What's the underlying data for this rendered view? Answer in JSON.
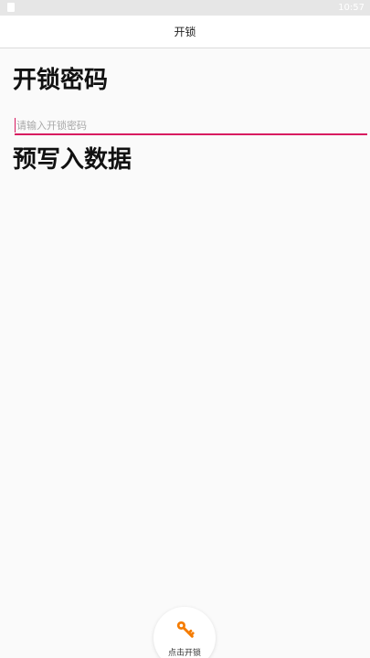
{
  "status_bar": {
    "time": "10:57"
  },
  "app_bar": {
    "title": "开锁"
  },
  "password_section": {
    "title": "开锁密码",
    "input_value": "",
    "input_placeholder": "请输入开锁密码"
  },
  "prewrite_section": {
    "title": "预写入数据"
  },
  "unlock_button": {
    "label": "点击开锁",
    "icon": "key-icon"
  },
  "colors": {
    "accent": "#d81b60",
    "key_icon": "#f57c00",
    "background": "#fafafa"
  }
}
